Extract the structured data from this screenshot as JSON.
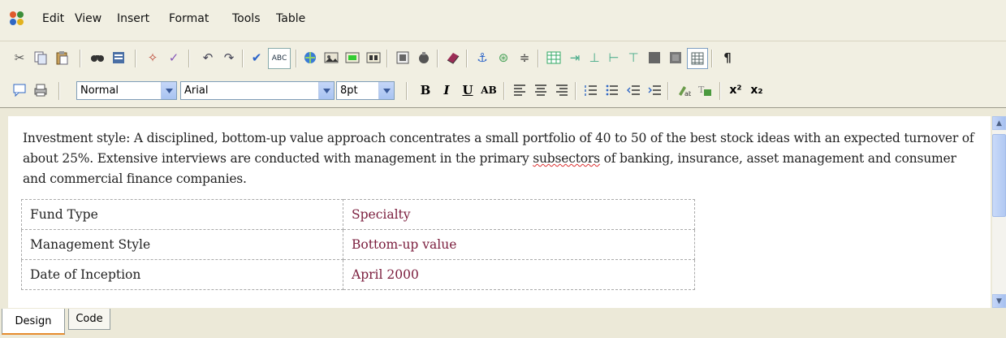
{
  "menu": {
    "logo_icon": "app-logo-icon",
    "items": [
      "Edit",
      "View",
      "Insert",
      "Format",
      "Tools",
      "Table"
    ]
  },
  "toolbar": {
    "block_format": "Normal",
    "font_name": "Arial",
    "font_size": "8pt",
    "spell_label": "ABC",
    "bold": "B",
    "italic": "I",
    "underline": "U",
    "caps": "AB",
    "superscript": "x²",
    "subscript": "x₂",
    "pilcrow": "¶"
  },
  "editor": {
    "paragraph_text_1": "Investment style: A disciplined, bottom-up value approach concentrates a small portfolio of 40 to 50 of the best stock ideas with an expected turnover of about 25%. Extensive interviews are conducted with management in the primary ",
    "paragraph_misspelled": "subsectors",
    "paragraph_text_2": " of banking, insurance, asset management and consumer and commercial finance companies.",
    "table": [
      {
        "key": "Fund Type",
        "value": "Specialty"
      },
      {
        "key": "Management Style",
        "value": "Bottom-up value"
      },
      {
        "key": "Date of Inception",
        "value": "April 2000"
      }
    ]
  },
  "tabs": {
    "design": "Design",
    "code": "Code"
  },
  "colors": {
    "table_value": "#7a1c3c",
    "accent_tab": "#e68b2c"
  }
}
